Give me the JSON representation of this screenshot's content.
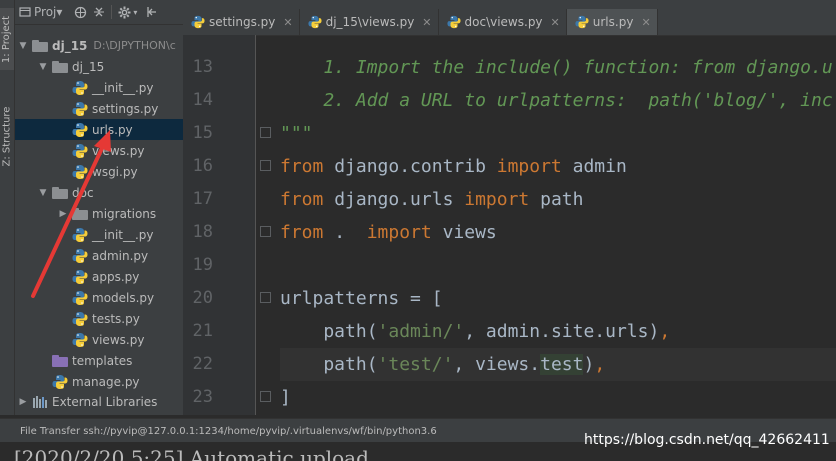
{
  "sidebar_tabs": {
    "project": "1: Project",
    "structure": "Z: Structure"
  },
  "project_panel": {
    "view_label": "Proj▾",
    "tree": [
      {
        "label": "dj_15",
        "path": "D:\\DJPYTHON\\c",
        "indent": 0,
        "type": "folder",
        "expanded": true,
        "bold": true
      },
      {
        "label": "dj_15",
        "indent": 1,
        "type": "folder",
        "expanded": true
      },
      {
        "label": "__init__.py",
        "indent": 2,
        "type": "py"
      },
      {
        "label": "settings.py",
        "indent": 2,
        "type": "py"
      },
      {
        "label": "urls.py",
        "indent": 2,
        "type": "py",
        "selected": true
      },
      {
        "label": "views.py",
        "indent": 2,
        "type": "py"
      },
      {
        "label": "wsgi.py",
        "indent": 2,
        "type": "py"
      },
      {
        "label": "doc",
        "indent": 1,
        "type": "folder",
        "expanded": true
      },
      {
        "label": "migrations",
        "indent": 2,
        "type": "folder",
        "expanded": false
      },
      {
        "label": "__init__.py",
        "indent": 2,
        "type": "py"
      },
      {
        "label": "admin.py",
        "indent": 2,
        "type": "py"
      },
      {
        "label": "apps.py",
        "indent": 2,
        "type": "py"
      },
      {
        "label": "models.py",
        "indent": 2,
        "type": "py"
      },
      {
        "label": "tests.py",
        "indent": 2,
        "type": "py"
      },
      {
        "label": "views.py",
        "indent": 2,
        "type": "py"
      },
      {
        "label": "templates",
        "indent": 1,
        "type": "folder-purple"
      },
      {
        "label": "manage.py",
        "indent": 1,
        "type": "py"
      }
    ],
    "external_libraries": "External Libraries"
  },
  "editor_tabs": [
    {
      "label": "settings.py",
      "active": false
    },
    {
      "label": "dj_15\\views.py",
      "active": false
    },
    {
      "label": "doc\\views.py",
      "active": false
    },
    {
      "label": "urls.py",
      "active": true
    }
  ],
  "code_lines": [
    {
      "num": "13",
      "fold": false,
      "highlight": false,
      "tokens": [
        {
          "t": "    1. Import the include() function: from django.u",
          "c": "doc"
        }
      ]
    },
    {
      "num": "14",
      "fold": false,
      "highlight": false,
      "tokens": [
        {
          "t": "    2. Add a URL to urlpatterns:  path('blog/', inc",
          "c": "doc"
        }
      ]
    },
    {
      "num": "15",
      "fold": true,
      "highlight": false,
      "tokens": [
        {
          "t": "\"\"\"",
          "c": "doc"
        }
      ]
    },
    {
      "num": "16",
      "fold": true,
      "highlight": false,
      "tokens": [
        {
          "t": "from",
          "c": "kw"
        },
        {
          "t": " django.contrib ",
          "c": ""
        },
        {
          "t": "import",
          "c": "kw"
        },
        {
          "t": " admin",
          "c": ""
        }
      ]
    },
    {
      "num": "17",
      "fold": false,
      "highlight": false,
      "tokens": [
        {
          "t": "from",
          "c": "kw"
        },
        {
          "t": " django.urls ",
          "c": ""
        },
        {
          "t": "import",
          "c": "kw"
        },
        {
          "t": " path",
          "c": ""
        }
      ]
    },
    {
      "num": "18",
      "fold": true,
      "highlight": false,
      "tokens": [
        {
          "t": "from",
          "c": "kw"
        },
        {
          "t": " .  ",
          "c": ""
        },
        {
          "t": "import",
          "c": "kw"
        },
        {
          "t": " views",
          "c": ""
        }
      ]
    },
    {
      "num": "19",
      "fold": false,
      "highlight": false,
      "tokens": []
    },
    {
      "num": "20",
      "fold": true,
      "highlight": false,
      "tokens": [
        {
          "t": "urlpatterns = [",
          "c": ""
        }
      ]
    },
    {
      "num": "21",
      "fold": false,
      "highlight": false,
      "tokens": [
        {
          "t": "    path(",
          "c": ""
        },
        {
          "t": "'admin/'",
          "c": "str"
        },
        {
          "t": ", admin.site.urls)",
          "c": ""
        },
        {
          "t": ",",
          "c": "kw"
        }
      ]
    },
    {
      "num": "22",
      "fold": false,
      "highlight": true,
      "tokens": [
        {
          "t": "    path(",
          "c": ""
        },
        {
          "t": "'test/'",
          "c": "str"
        },
        {
          "t": ", views.",
          "c": ""
        },
        {
          "t": "test",
          "c": "ident-hl"
        },
        {
          "t": ")",
          "c": ""
        },
        {
          "t": ",",
          "c": "kw"
        }
      ]
    },
    {
      "num": "23",
      "fold": true,
      "highlight": false,
      "tokens": [
        {
          "t": "]",
          "c": ""
        }
      ]
    }
  ],
  "status_bar": {
    "text": "File Transfer ssh://pyvip@127.0.0.1:1234/home/pyvip/.virtualenvs/wf/bin/python3.6"
  },
  "console": {
    "text": "[2020/2/20 5:25] Automatic upload"
  },
  "watermark": "https://blog.csdn.net/qq_42662411",
  "colors": {
    "bg": "#2b2b2b",
    "panel": "#3c3f41",
    "keyword": "#cc7832",
    "docstring": "#629755",
    "string": "#6a8759",
    "annotation_arrow": "#e53935"
  }
}
